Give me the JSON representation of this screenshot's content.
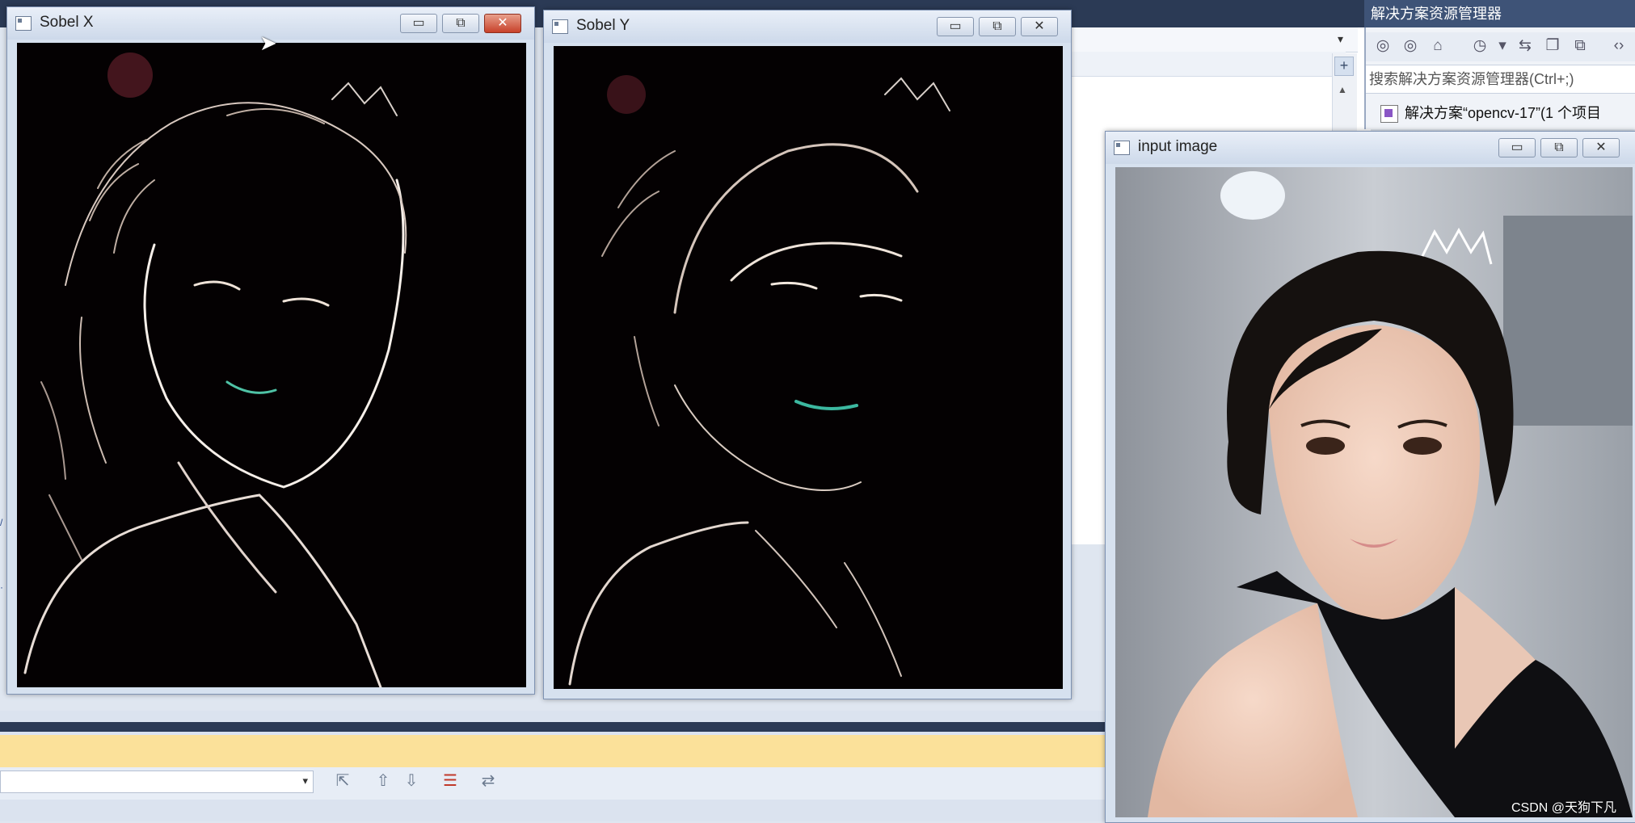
{
  "ide": {
    "solution_explorer": {
      "title": "解决方案资源管理器",
      "search_placeholder": "搜索解决方案资源管理器(Ctrl+;)",
      "tree_item": "解决方案“opencv-17”(1 个项目"
    }
  },
  "windows": {
    "sobel_x": {
      "title": "Sobel X"
    },
    "sobel_y": {
      "title": "Sobel Y"
    },
    "input": {
      "title": "input image"
    }
  },
  "controls": {
    "minimize": "▭",
    "maximize": "⧉",
    "close": "✕"
  },
  "watermark": "CSDN @天狗下凡",
  "colors": {
    "ide_dark": "#2b3a55",
    "highlight_yellow": "#fbe19a",
    "titlebar_light": "#e9eff8",
    "close_red": "#c8412a"
  }
}
